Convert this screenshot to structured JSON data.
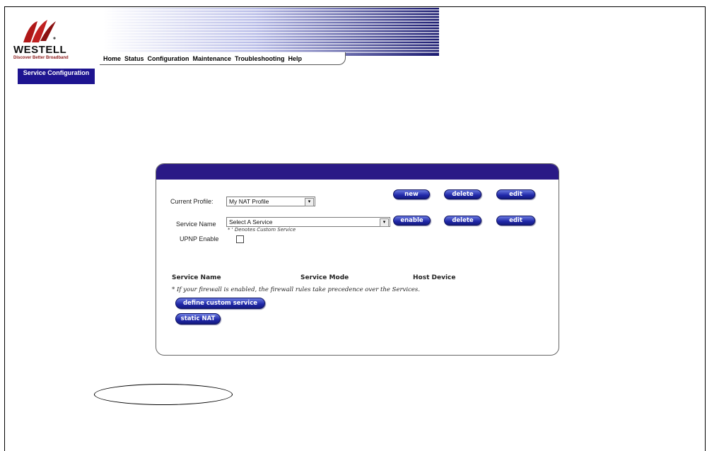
{
  "brand": {
    "name": "WESTELL",
    "tagline": "Discover Better Broadband",
    "color": "#8b1a1a"
  },
  "nav": {
    "items": [
      "Home",
      "Status",
      "Configuration",
      "Maintenance",
      "Troubleshooting",
      "Help"
    ]
  },
  "sidebar": {
    "tab_label": "Service Configuration",
    "color": "#1e1490"
  },
  "profile": {
    "label": "Current Profile:",
    "value": "My NAT Profile",
    "buttons": [
      "new",
      "delete",
      "edit"
    ]
  },
  "service": {
    "label": "Service Name",
    "value": "Select A Service",
    "note": "* ' Denotes Custom Service",
    "buttons": [
      "enable",
      "delete",
      "edit"
    ]
  },
  "upnp": {
    "label": "UPNP Enable",
    "checked": false
  },
  "table": {
    "headers": [
      "Service Name",
      "Service Mode",
      "Host Device"
    ]
  },
  "firewall_note": "* If your firewall is enabled, the firewall rules take precedence over the Services.",
  "actions": {
    "define_custom": "define custom service",
    "static_nat": "static NAT"
  },
  "colors": {
    "panel_header": "#2a1a86",
    "button": "#2028a8"
  }
}
